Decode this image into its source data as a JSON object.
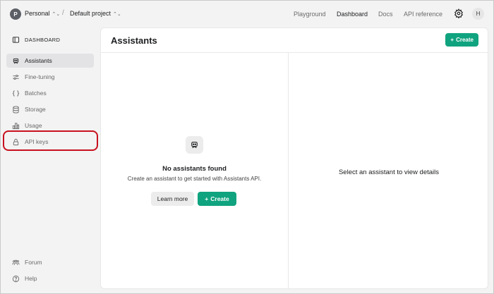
{
  "topbar": {
    "org_initial": "P",
    "org_name": "Personal",
    "separator": "/",
    "project_name": "Default project",
    "nav": {
      "playground": "Playground",
      "dashboard": "Dashboard",
      "docs": "Docs",
      "api_reference": "API reference"
    },
    "user_initial": "H"
  },
  "sidebar": {
    "header": "DASHBOARD",
    "items": [
      {
        "label": "Assistants",
        "icon": "robot-icon",
        "active": true
      },
      {
        "label": "Fine-tuning",
        "icon": "sliders-icon",
        "active": false
      },
      {
        "label": "Batches",
        "icon": "braces-icon",
        "active": false
      },
      {
        "label": "Storage",
        "icon": "database-icon",
        "active": false
      },
      {
        "label": "Usage",
        "icon": "bar-chart-icon",
        "active": false
      },
      {
        "label": "API keys",
        "icon": "lock-icon",
        "active": false
      }
    ],
    "bottom": [
      {
        "label": "Forum",
        "icon": "people-icon"
      },
      {
        "label": "Help",
        "icon": "help-icon"
      }
    ]
  },
  "main": {
    "title": "Assistants",
    "create_label": "Create",
    "empty_state": {
      "title": "No assistants found",
      "subtitle": "Create an assistant to get started with Assistants API.",
      "learn_more": "Learn more",
      "create": "Create"
    },
    "detail_placeholder": "Select an assistant to view details"
  },
  "colors": {
    "accent": "#10a37f",
    "highlight": "#c8101f"
  }
}
